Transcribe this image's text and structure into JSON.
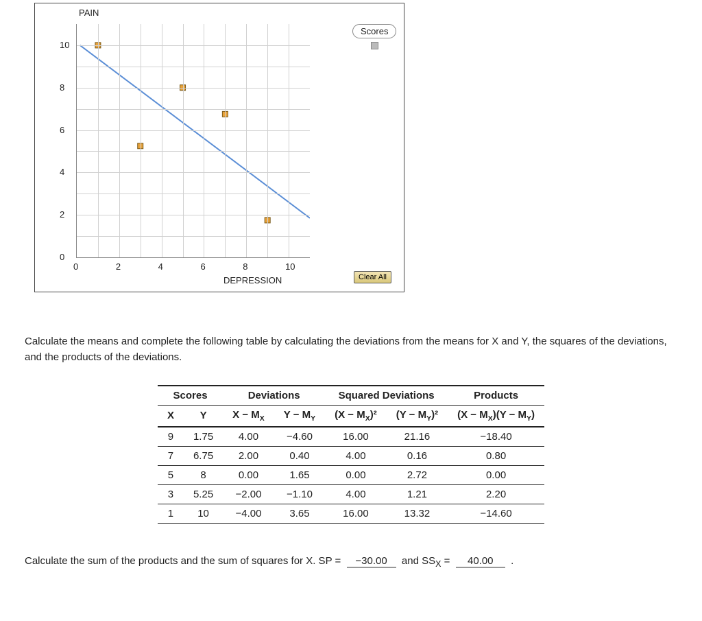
{
  "chart_data": {
    "type": "scatter",
    "title": "",
    "xlabel": "DEPRESSION",
    "ylabel": "PAIN",
    "xlim": [
      0,
      11
    ],
    "ylim": [
      0,
      11
    ],
    "xticks": [
      0,
      2,
      4,
      6,
      8,
      10
    ],
    "yticks": [
      0,
      2,
      4,
      6,
      8,
      10
    ],
    "series": [
      {
        "name": "Scores",
        "type": "scatter",
        "points": [
          {
            "x": 1,
            "y": 10
          },
          {
            "x": 3,
            "y": 5.25
          },
          {
            "x": 5,
            "y": 8
          },
          {
            "x": 7,
            "y": 6.75
          },
          {
            "x": 9,
            "y": 1.75
          }
        ]
      },
      {
        "name": "Fit line",
        "type": "line",
        "slope": -0.75,
        "intercept": 10.1,
        "p0": {
          "x": 0.15,
          "y": 10
        },
        "p1": {
          "x": 11,
          "y": 1.85
        }
      }
    ],
    "legend": {
      "position": "right",
      "label": "Scores"
    }
  },
  "ui": {
    "clear_button": "Clear All",
    "legend_label": "Scores"
  },
  "instructions": "Calculate the means and complete the following table by calculating the deviations from the means for X and Y, the squares of the deviations, and the products of the deviations.",
  "table": {
    "group_headers": [
      "Scores",
      "Deviations",
      "Squared Deviations",
      "Products"
    ],
    "sub_headers": {
      "x": "X",
      "y": "Y",
      "dx": "X − M<sub>X</sub>",
      "dy": "Y − M<sub>Y</sub>",
      "dx2": "(X − M<sub>X</sub>)²",
      "dy2": "(Y − M<sub>Y</sub>)²",
      "prod": "(X − M<sub>X</sub>)(Y − M<sub>Y</sub>)"
    },
    "rows": [
      {
        "x": "9",
        "y": "1.75",
        "dx": "4.00",
        "dy": "−4.60",
        "dx2": "16.00",
        "dy2": "21.16",
        "prod": "−18.40"
      },
      {
        "x": "7",
        "y": "6.75",
        "dx": "2.00",
        "dy": "0.40",
        "dx2": "4.00",
        "dy2": "0.16",
        "prod": "0.80"
      },
      {
        "x": "5",
        "y": "8",
        "dx": "0.00",
        "dy": "1.65",
        "dx2": "0.00",
        "dy2": "2.72",
        "prod": "0.00"
      },
      {
        "x": "3",
        "y": "5.25",
        "dx": "−2.00",
        "dy": "−1.10",
        "dx2": "4.00",
        "dy2": "1.21",
        "prod": "2.20"
      },
      {
        "x": "1",
        "y": "10",
        "dx": "−4.00",
        "dy": "3.65",
        "dx2": "16.00",
        "dy2": "13.32",
        "prod": "−14.60"
      }
    ]
  },
  "results": {
    "prompt_prefix": "Calculate the sum of the products and the sum of squares for X. SP =",
    "sp": "−30.00",
    "and_ssx_label": "and SS",
    "ssx_sub": "X",
    "equals": " =",
    "ssx": "40.00",
    "period": "."
  }
}
